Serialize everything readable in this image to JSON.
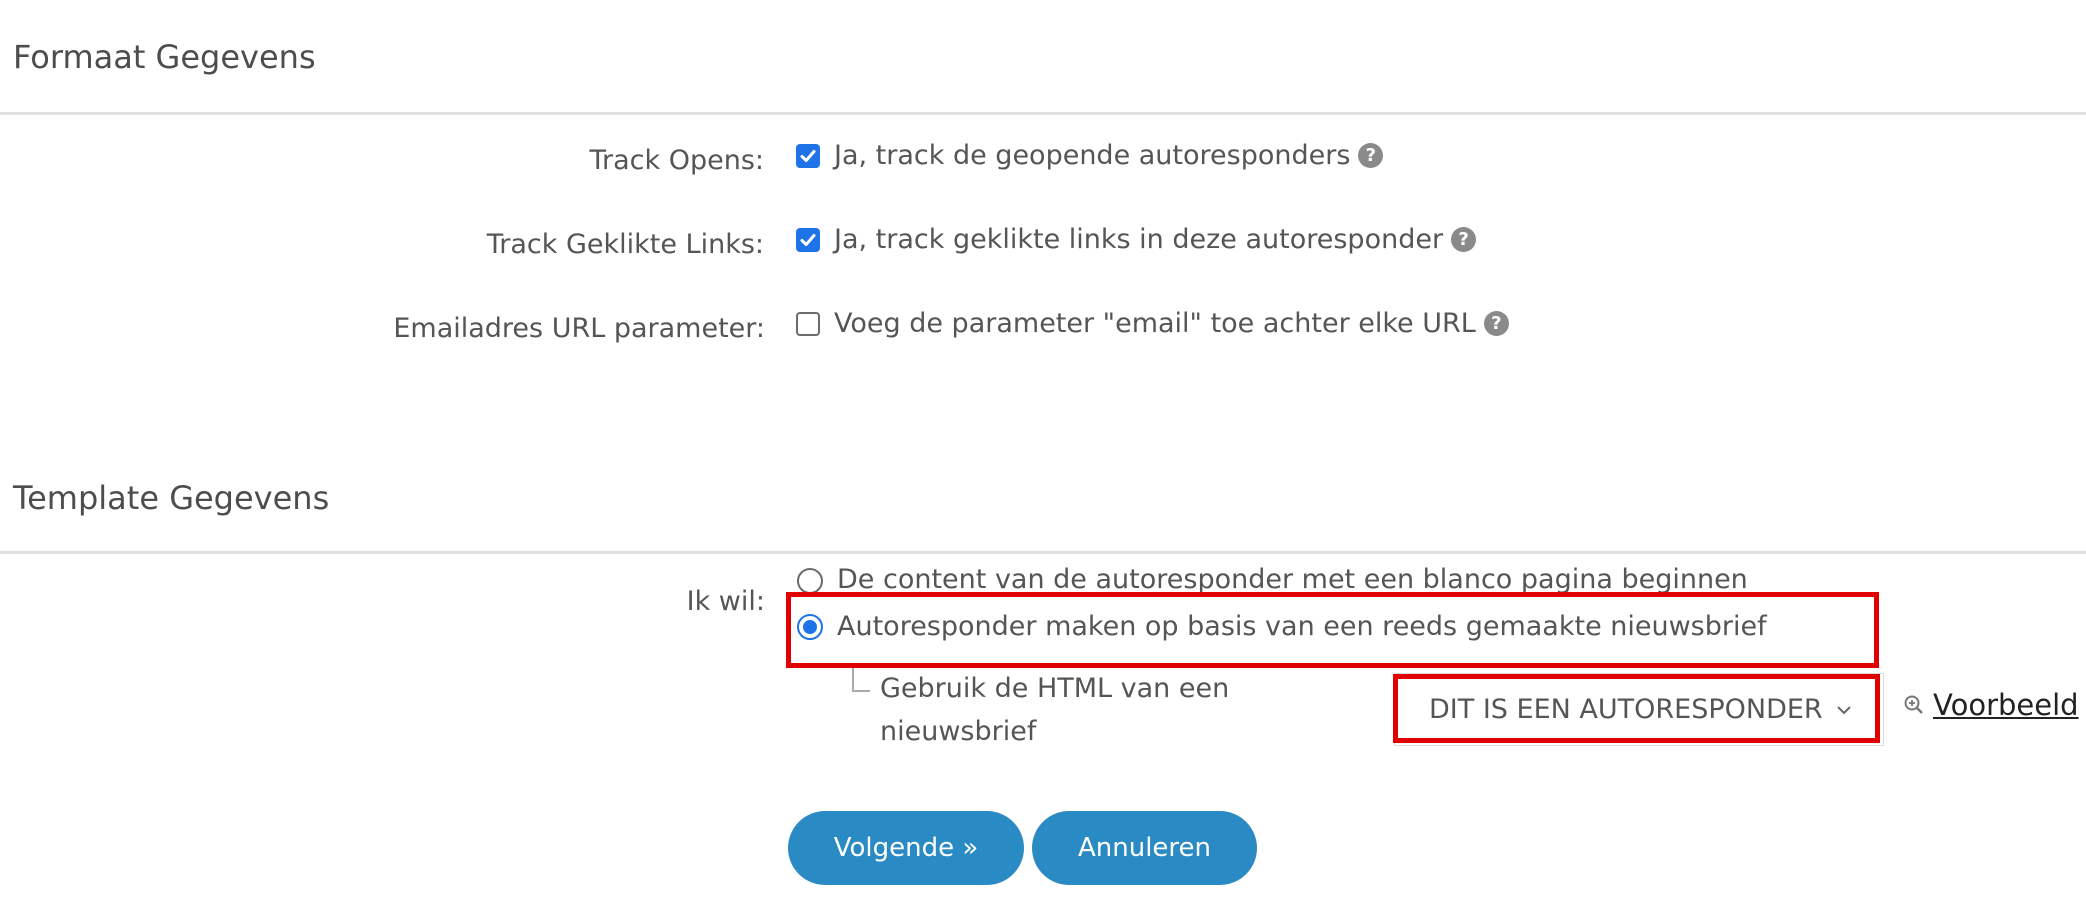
{
  "format_section": {
    "title": "Formaat Gegevens",
    "track_opens": {
      "label": "Track Opens:",
      "option": "Ja, track de geopende autoresponders",
      "checked": true
    },
    "track_links": {
      "label": "Track Geklikte Links:",
      "option": "Ja, track geklikte links in deze autoresponder",
      "checked": true
    },
    "email_param": {
      "label": "Emailadres URL parameter:",
      "option": "Voeg de parameter \"email\" toe achter elke URL",
      "checked": false
    },
    "help_glyph": "?"
  },
  "template_section": {
    "title": "Template Gegevens",
    "ik_wil_label": "Ik wil:",
    "options": [
      {
        "label": "De content van de autoresponder met een blanco pagina beginnen",
        "selected": false
      },
      {
        "label": "Autoresponder maken op basis van een reeds gemaakte nieuwsbrief",
        "selected": true
      }
    ],
    "sub_label": "Gebruik de HTML van een nieuwsbrief",
    "select_value": "DIT IS EEN AUTORESPONDER",
    "preview_link": "Voorbeeld"
  },
  "buttons": {
    "next": "Volgende »",
    "cancel": "Annuleren"
  },
  "colors": {
    "accent_blue": "#1f73e8",
    "button_blue": "#2a8ac4",
    "highlight_red": "#e00000"
  },
  "icons": {
    "checkbox_checked": "check-icon",
    "help": "question-circle-icon",
    "select": "chevron-down-icon",
    "preview": "zoom-in-icon"
  }
}
